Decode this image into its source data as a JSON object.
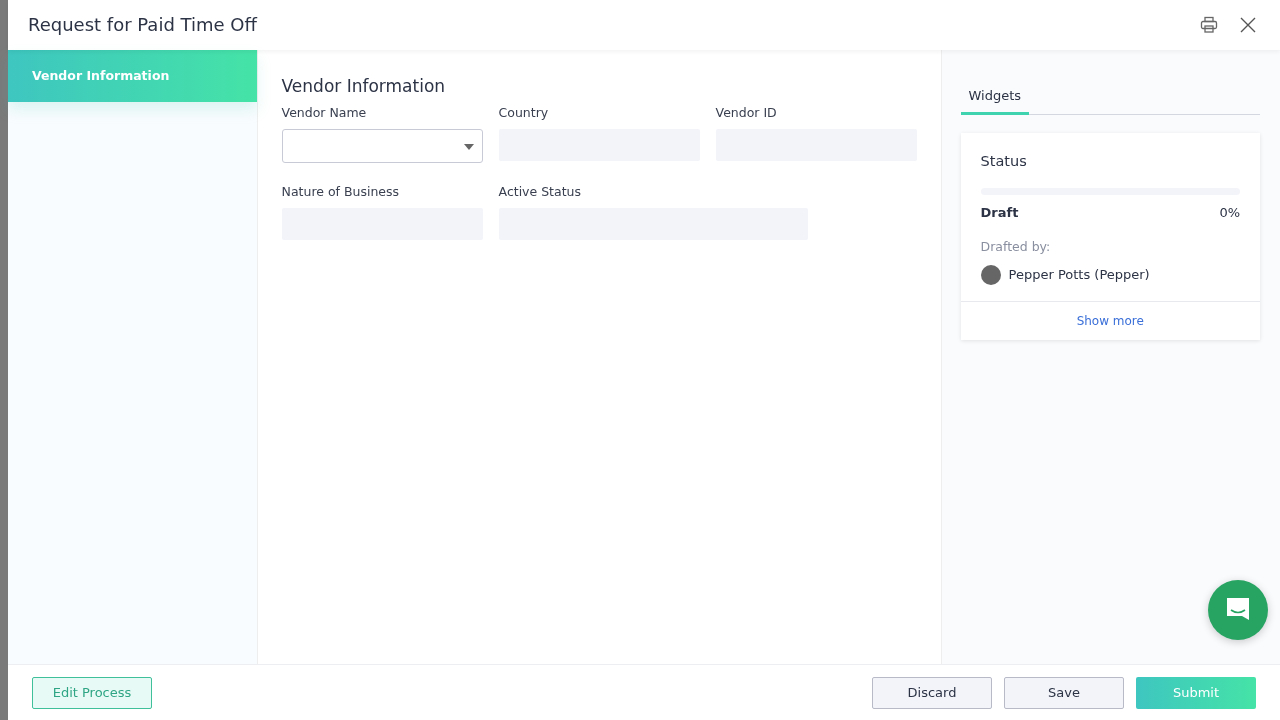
{
  "window": {
    "title": "Request for Paid Time Off"
  },
  "sidebar": {
    "items": [
      {
        "label": "Vendor Information",
        "selected": true
      }
    ]
  },
  "form": {
    "title": "Vendor Information",
    "rows": [
      [
        {
          "label": "Vendor Name",
          "kind": "select"
        },
        {
          "label": "Country",
          "kind": "text"
        },
        {
          "label": "Vendor ID",
          "kind": "text"
        }
      ],
      [
        {
          "label": "Nature of Business",
          "kind": "text"
        },
        {
          "label": "Active Status",
          "kind": "text"
        }
      ]
    ]
  },
  "panel": {
    "tabs": [
      {
        "label": "Widgets",
        "selected": true
      }
    ],
    "status": {
      "title": "Status",
      "level": 0,
      "stage": "Draft",
      "percent": "0%",
      "drafted_label": "Drafted by:",
      "drafted_by": "Pepper Potts (Pepper)",
      "link": "Show more"
    }
  },
  "footer": {
    "left_button": "Edit Process",
    "buttons": [
      {
        "label": "Discard",
        "kind": "secondary"
      },
      {
        "label": "Save",
        "kind": "secondary"
      },
      {
        "label": "Submit",
        "kind": "primary"
      }
    ]
  }
}
